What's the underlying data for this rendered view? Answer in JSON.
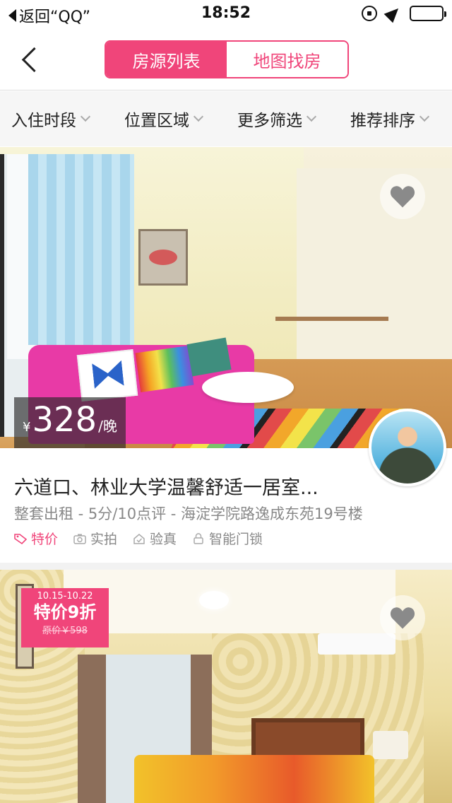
{
  "status_bar": {
    "back_text": "返回“QQ”",
    "time": "18:52"
  },
  "nav": {
    "tabs": [
      {
        "label": "房源列表",
        "active": true
      },
      {
        "label": "地图找房",
        "active": false
      }
    ],
    "accent_color": "#f0457a"
  },
  "filters": [
    {
      "label": "入住时段"
    },
    {
      "label": "位置区域"
    },
    {
      "label": "更多筛选"
    },
    {
      "label": "推荐排序"
    }
  ],
  "listings": [
    {
      "price_currency": "¥",
      "price": "328",
      "price_unit": "/晚",
      "title": "六道口、林业大学温馨舒适一居室...",
      "subtitle": "整套出租 - 5分/10点评 - 海淀学院路逸成东苑19号楼",
      "tags": [
        {
          "label": "特价",
          "icon": "price-tag-icon",
          "highlight": true
        },
        {
          "label": "实拍",
          "icon": "camera-icon",
          "highlight": false
        },
        {
          "label": "验真",
          "icon": "house-check-icon",
          "highlight": false
        },
        {
          "label": "智能门锁",
          "icon": "lock-icon",
          "highlight": false
        }
      ]
    },
    {
      "promo": {
        "dates": "10.15-10.22",
        "text": "特价9折",
        "original_price": "原价￥598"
      }
    }
  ]
}
